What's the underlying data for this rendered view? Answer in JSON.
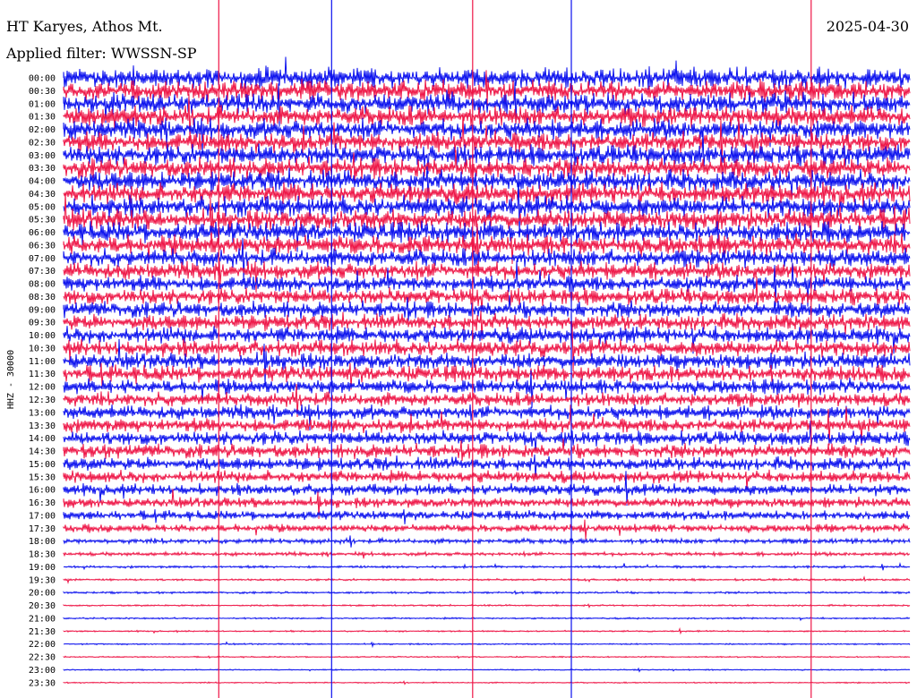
{
  "header": {
    "station": "HT Karyes, Athos Mt.",
    "filter": "Applied filter: WWSSN-SP",
    "date": "2025-04-30"
  },
  "colors": {
    "odd_trace": "#0a10ee",
    "even_trace": "#ee1546",
    "background": "#ffffff"
  },
  "chart_data": {
    "type": "helicorder",
    "ylabel": "HHZ - 30000",
    "row_interval_minutes": 30,
    "tick_labels": [
      "00:00",
      "00:30",
      "01:00",
      "01:30",
      "02:00",
      "02:30",
      "03:00",
      "03:30",
      "04:00",
      "04:30",
      "05:00",
      "05:30",
      "06:00",
      "06:30",
      "07:00",
      "07:30",
      "08:00",
      "08:30",
      "09:00",
      "09:30",
      "10:00",
      "10:30",
      "11:00",
      "11:30",
      "12:00",
      "12:30",
      "13:00",
      "13:30",
      "14:00",
      "14:30",
      "15:00",
      "15:30",
      "16:00",
      "16:30",
      "17:00",
      "17:30",
      "18:00",
      "18:30",
      "19:00",
      "19:30",
      "20:00",
      "20:30",
      "21:00",
      "21:30",
      "22:00",
      "22:30",
      "23:00",
      "23:30"
    ],
    "trace_colors": [
      "blue",
      "red"
    ],
    "noise_amplitude_relative": [
      1.0,
      1.0,
      1.0,
      1.0,
      1.0,
      1.0,
      1.0,
      1.0,
      1.0,
      1.0,
      1.0,
      1.0,
      1.0,
      1.0,
      0.9,
      0.85,
      0.8,
      0.8,
      0.8,
      0.8,
      0.8,
      0.8,
      0.8,
      0.8,
      0.75,
      0.7,
      0.7,
      0.7,
      0.7,
      0.7,
      0.65,
      0.6,
      0.55,
      0.5,
      0.45,
      0.4,
      0.25,
      0.18,
      0.12,
      0.1,
      0.1,
      0.08,
      0.08,
      0.07,
      0.07,
      0.06,
      0.06,
      0.06
    ],
    "persistent_spikes_minute_offset": [
      5.5,
      9.5,
      14.5,
      18.0,
      26.5
    ]
  }
}
